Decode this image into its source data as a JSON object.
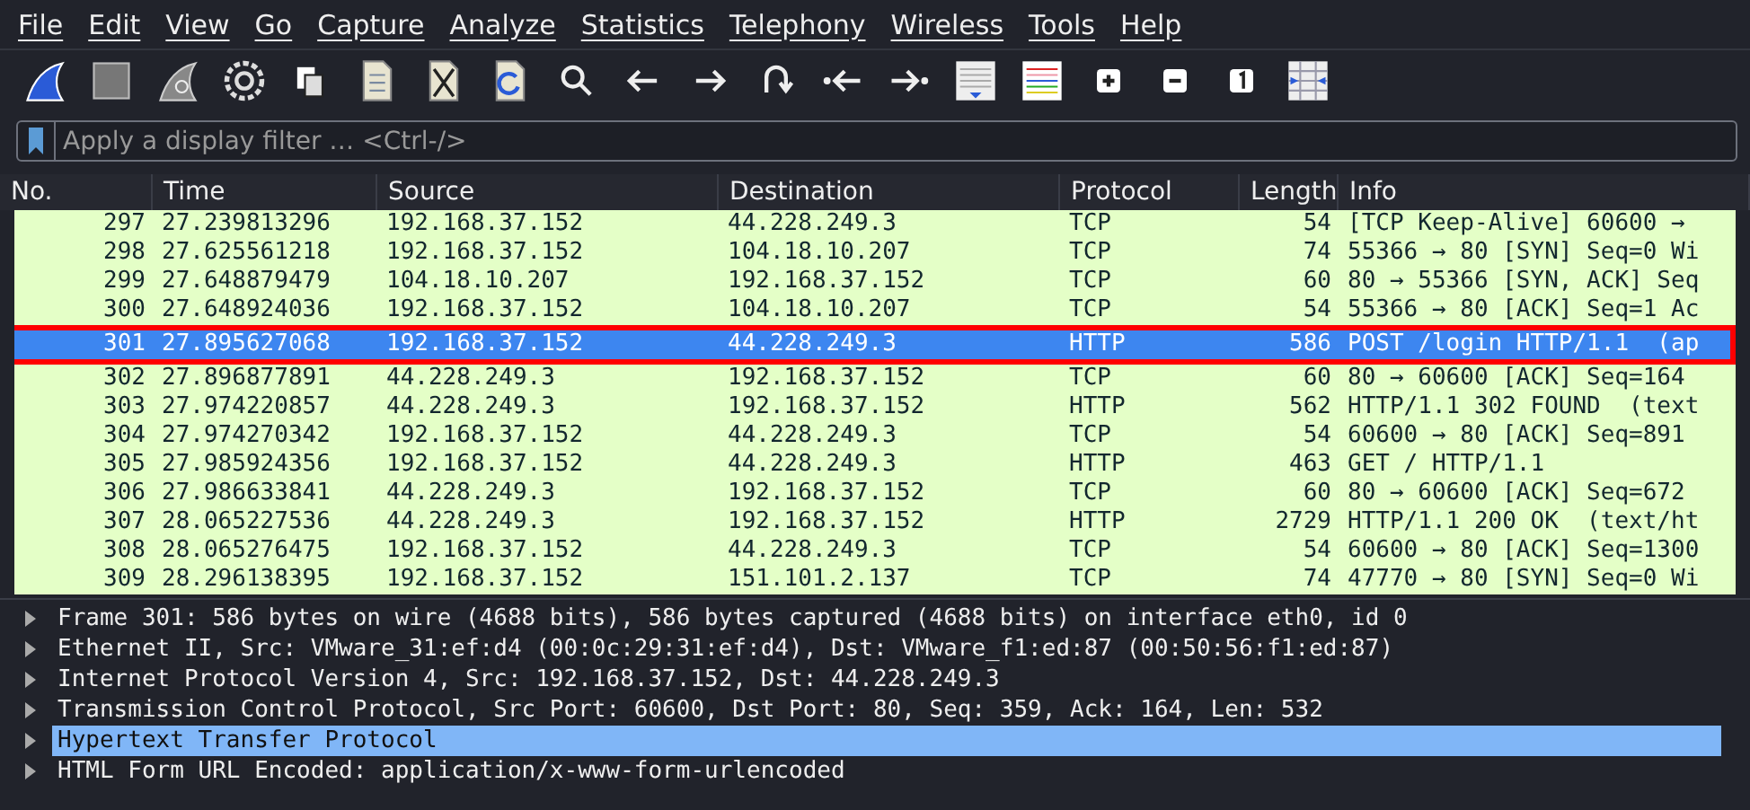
{
  "menu": [
    "File",
    "Edit",
    "View",
    "Go",
    "Capture",
    "Analyze",
    "Statistics",
    "Telephony",
    "Wireless",
    "Tools",
    "Help"
  ],
  "filter": {
    "placeholder": "Apply a display filter … <Ctrl-/>"
  },
  "table": {
    "columns": [
      "No.",
      "Time",
      "Source",
      "Destination",
      "Protocol",
      "Length",
      "Info"
    ],
    "rows": [
      {
        "cells": [
          "297",
          "27.239813296",
          "192.168.37.152",
          "44.228.249.3",
          "TCP",
          "54",
          "[TCP Keep-Alive] 60600 →"
        ],
        "selected": false,
        "highlighted": false
      },
      {
        "cells": [
          "298",
          "27.625561218",
          "192.168.37.152",
          "104.18.10.207",
          "TCP",
          "74",
          "55366 → 80 [SYN] Seq=0 Wi"
        ],
        "selected": false,
        "highlighted": false
      },
      {
        "cells": [
          "299",
          "27.648879479",
          "104.18.10.207",
          "192.168.37.152",
          "TCP",
          "60",
          "80 → 55366 [SYN, ACK] Seq"
        ],
        "selected": false,
        "highlighted": false
      },
      {
        "cells": [
          "300",
          "27.648924036",
          "192.168.37.152",
          "104.18.10.207",
          "TCP",
          "54",
          "55366 → 80 [ACK] Seq=1 Ac"
        ],
        "selected": false,
        "highlighted": false
      },
      {
        "cells": [
          "301",
          "27.895627068",
          "192.168.37.152",
          "44.228.249.3",
          "HTTP",
          "586",
          "POST /login HTTP/1.1  (ap"
        ],
        "selected": true,
        "highlighted": true
      },
      {
        "cells": [
          "302",
          "27.896877891",
          "44.228.249.3",
          "192.168.37.152",
          "TCP",
          "60",
          "80 → 60600 [ACK] Seq=164"
        ],
        "selected": false,
        "highlighted": false
      },
      {
        "cells": [
          "303",
          "27.974220857",
          "44.228.249.3",
          "192.168.37.152",
          "HTTP",
          "562",
          "HTTP/1.1 302 FOUND  (text"
        ],
        "selected": false,
        "highlighted": false
      },
      {
        "cells": [
          "304",
          "27.974270342",
          "192.168.37.152",
          "44.228.249.3",
          "TCP",
          "54",
          "60600 → 80 [ACK] Seq=891"
        ],
        "selected": false,
        "highlighted": false
      },
      {
        "cells": [
          "305",
          "27.985924356",
          "192.168.37.152",
          "44.228.249.3",
          "HTTP",
          "463",
          "GET / HTTP/1.1"
        ],
        "selected": false,
        "highlighted": false
      },
      {
        "cells": [
          "306",
          "27.986633841",
          "44.228.249.3",
          "192.168.37.152",
          "TCP",
          "60",
          "80 → 60600 [ACK] Seq=672"
        ],
        "selected": false,
        "highlighted": false
      },
      {
        "cells": [
          "307",
          "28.065227536",
          "44.228.249.3",
          "192.168.37.152",
          "HTTP",
          "2729",
          "HTTP/1.1 200 OK  (text/ht"
        ],
        "selected": false,
        "highlighted": false
      },
      {
        "cells": [
          "308",
          "28.065276475",
          "192.168.37.152",
          "44.228.249.3",
          "TCP",
          "54",
          "60600 → 80 [ACK] Seq=1300"
        ],
        "selected": false,
        "highlighted": false
      },
      {
        "cells": [
          "309",
          "28.296138395",
          "192.168.37.152",
          "151.101.2.137",
          "TCP",
          "74",
          "47770 → 80 [SYN] Seq=0 Wi"
        ],
        "selected": false,
        "highlighted": false
      }
    ]
  },
  "details": [
    {
      "text": "Frame 301: 586 bytes on wire (4688 bits), 586 bytes captured (4688 bits) on interface eth0, id 0",
      "selected": false,
      "expanded": false
    },
    {
      "text": "Ethernet II, Src: VMware_31:ef:d4 (00:0c:29:31:ef:d4), Dst: VMware_f1:ed:87 (00:50:56:f1:ed:87)",
      "selected": false,
      "expanded": false
    },
    {
      "text": "Internet Protocol Version 4, Src: 192.168.37.152, Dst: 44.228.249.3",
      "selected": false,
      "expanded": false
    },
    {
      "text": "Transmission Control Protocol, Src Port: 60600, Dst Port: 80, Seq: 359, Ack: 164, Len: 532",
      "selected": false,
      "expanded": false
    },
    {
      "text": "Hypertext Transfer Protocol",
      "selected": true,
      "expanded": false
    },
    {
      "text": "HTML Form URL Encoded: application/x-www-form-urlencoded",
      "selected": false,
      "expanded": false
    }
  ]
}
